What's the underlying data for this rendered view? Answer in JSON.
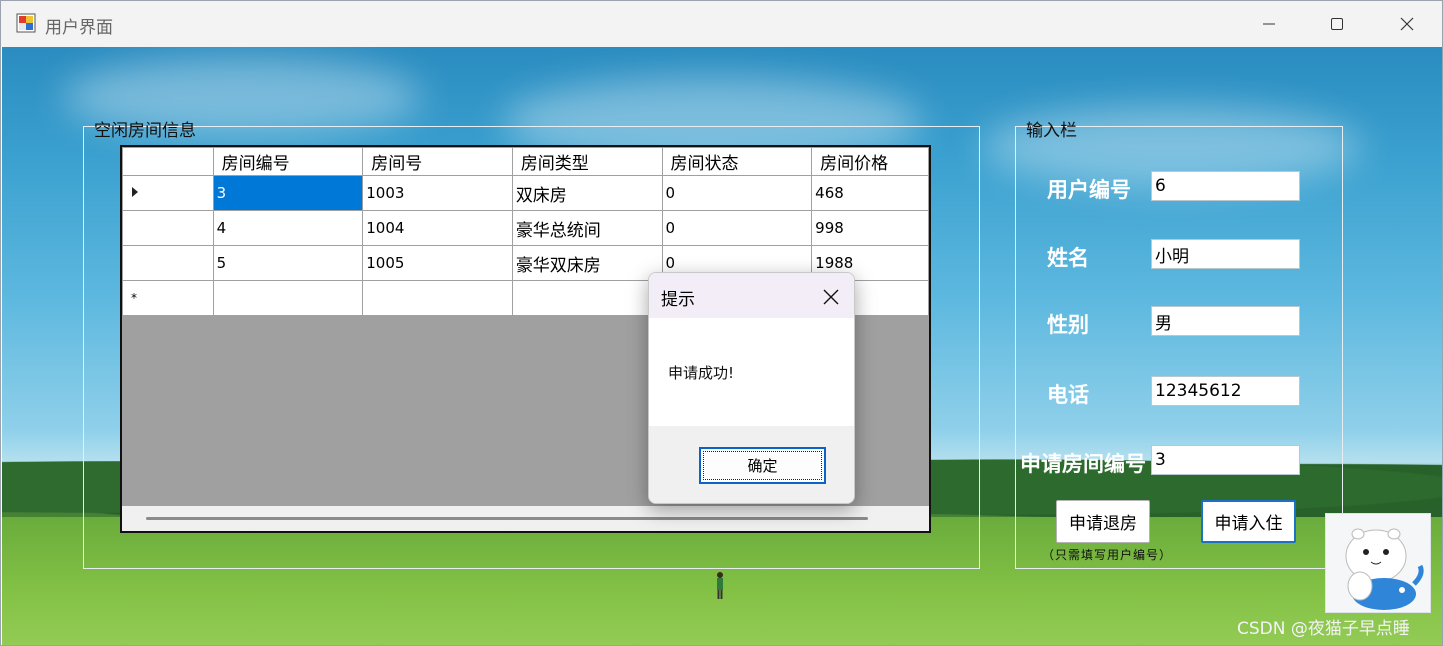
{
  "window": {
    "title": "用户界面",
    "controls": [
      "minimize",
      "maximize",
      "close"
    ]
  },
  "rooms_group": {
    "legend": "空闲房间信息",
    "columns": [
      "房间编号",
      "房间号",
      "房间类型",
      "房间状态",
      "房间价格"
    ],
    "rows": [
      {
        "cells": [
          "3",
          "1003",
          "双床房",
          "0",
          "468"
        ],
        "current": true
      },
      {
        "cells": [
          "4",
          "1004",
          "豪华总统间",
          "0",
          "998"
        ],
        "current": false
      },
      {
        "cells": [
          "5",
          "1005",
          "豪华双床房",
          "0",
          "1988"
        ],
        "current": false
      }
    ],
    "new_row_marker": "*"
  },
  "input_group": {
    "legend": "输入栏",
    "fields": [
      {
        "label": "用户编号",
        "value": "6"
      },
      {
        "label": "姓名",
        "value": "小明"
      },
      {
        "label": "性别",
        "value": "男"
      },
      {
        "label": "电话",
        "value": "12345612"
      },
      {
        "label": "申请房间编号",
        "value": "3"
      }
    ],
    "checkout_button": "申请退房",
    "checkin_button": "申请入住",
    "hint": "（只需填写用户编号）"
  },
  "dialog": {
    "title": "提示",
    "message": "申请成功!",
    "ok_button": "确定"
  },
  "watermark": "CSDN @夜猫子早点睡",
  "colors": {
    "selection": "#0078d7",
    "primary_border": "#1d71c5",
    "dialog_title_bg": "#f3edf7"
  },
  "icons": [
    "app-icon",
    "minimize-icon",
    "maximize-icon",
    "close-icon",
    "row-pointer-icon",
    "dialog-close-icon"
  ]
}
